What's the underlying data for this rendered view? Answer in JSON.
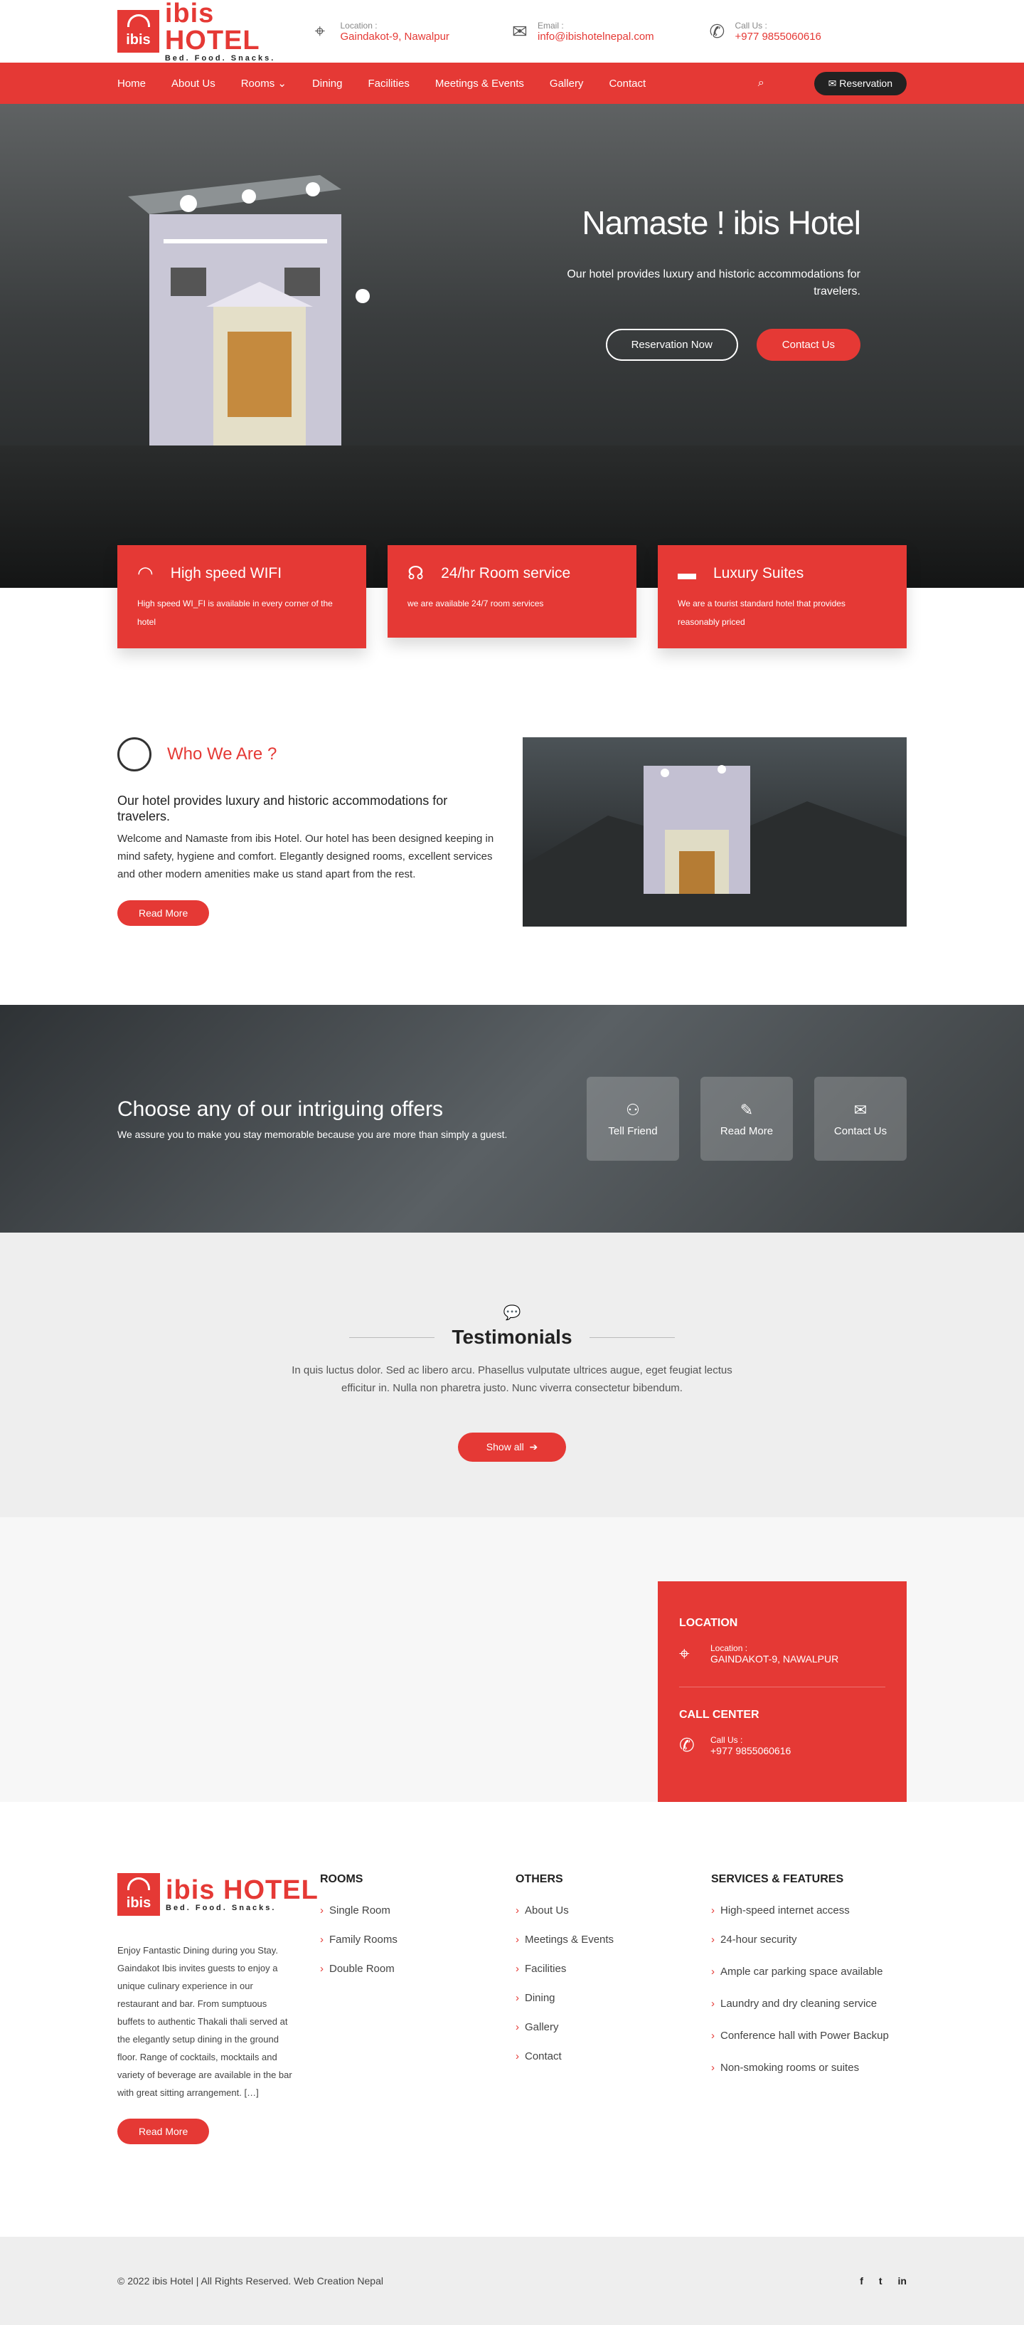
{
  "header": {
    "logo_text": "ibis HOTEL",
    "logo_badge": "ibis",
    "tagline": "Bed. Food. Snacks.",
    "location_label": "Location :",
    "location_value": "Gaindakot-9, Nawalpur",
    "email_label": "Email :",
    "email_value": "info@ibishotelnepal.com",
    "call_label": "Call Us :",
    "call_value": "+977 9855060616"
  },
  "nav": {
    "items": [
      "Home",
      "About Us",
      "Rooms ⌄",
      "Dining",
      "Facilities",
      "Meetings & Events",
      "Gallery",
      "Contact"
    ],
    "reservation": "✉ Reservation"
  },
  "hero": {
    "title": "Namaste ! ibis Hotel",
    "subtitle": "Our hotel provides luxury and historic accommodations for travelers.",
    "btn1": "Reservation Now",
    "btn2": "Contact Us"
  },
  "features": [
    {
      "title": "High speed WIFI",
      "text": "High speed WI_FI is available in every corner of the hotel",
      "icon": "wifi-icon"
    },
    {
      "title": "24/hr Room service",
      "text": "we are available 24/7 room services",
      "icon": "headset-icon"
    },
    {
      "title": "Luxury Suites",
      "text": "We are a tourist standard hotel that provides reasonably priced",
      "icon": "bed-icon"
    }
  ],
  "about": {
    "heading": "Who We Are ?",
    "subheading": "Our hotel provides luxury and historic accommodations for travelers.",
    "text": "Welcome and Namaste from ibis Hotel. Our hotel has been designed keeping in mind safety, hygiene and comfort. Elegantly designed rooms, excellent services and other modern amenities make us stand apart from the rest.",
    "button": "Read More"
  },
  "offers": {
    "title": "Choose any of our intriguing offers",
    "text": "We assure you to make you stay memorable because you are more than simply a guest.",
    "buttons": [
      "Tell Friend",
      "Read More",
      "Contact Us"
    ]
  },
  "testimonials": {
    "title": "Testimonials",
    "text": "In quis luctus dolor. Sed ac libero arcu. Phasellus vulputate ultrices augue, eget feugiat lectus efficitur in. Nulla non pharetra justo. Nunc viverra consectetur bibendum.",
    "button": "Show all"
  },
  "contact": {
    "location_title": "LOCATION",
    "location_label": "Location :",
    "location_value": "GAINDAKOT-9, NAWALPUR",
    "call_title": "CALL CENTER",
    "call_label": "Call Us :",
    "call_value": "+977 9855060616"
  },
  "footer": {
    "about": "Enjoy Fantastic Dining during you Stay. Gaindakot Ibis invites guests to enjoy a unique culinary experience in our restaurant and bar. From sumptuous buffets to authentic Thakali thali served at the elegantly setup dining in the ground floor. Range of cocktails, mocktails and variety of beverage are available in the bar with great sitting arrangement. […]",
    "read_more": "Read More",
    "rooms_title": "ROOMS",
    "rooms": [
      "Single Room",
      "Family Rooms",
      "Double Room"
    ],
    "others_title": "OTHERS",
    "others": [
      "About Us",
      "Meetings & Events",
      "Facilities",
      "Dining",
      "Gallery",
      "Contact"
    ],
    "services_title": "SERVICES & FEATURES",
    "services": [
      "High-speed internet access",
      "24-hour security",
      "Ample car parking space available",
      "Laundry and dry cleaning service",
      "Conference hall with Power Backup",
      "Non-smoking rooms or suites"
    ]
  },
  "bottom": {
    "copyright": "© 2022 ibis Hotel | All Rights Reserved. Web Creation Nepal",
    "social": [
      "f",
      "t",
      "in"
    ]
  },
  "colors": {
    "accent": "#e53935",
    "dark": "#222222"
  }
}
